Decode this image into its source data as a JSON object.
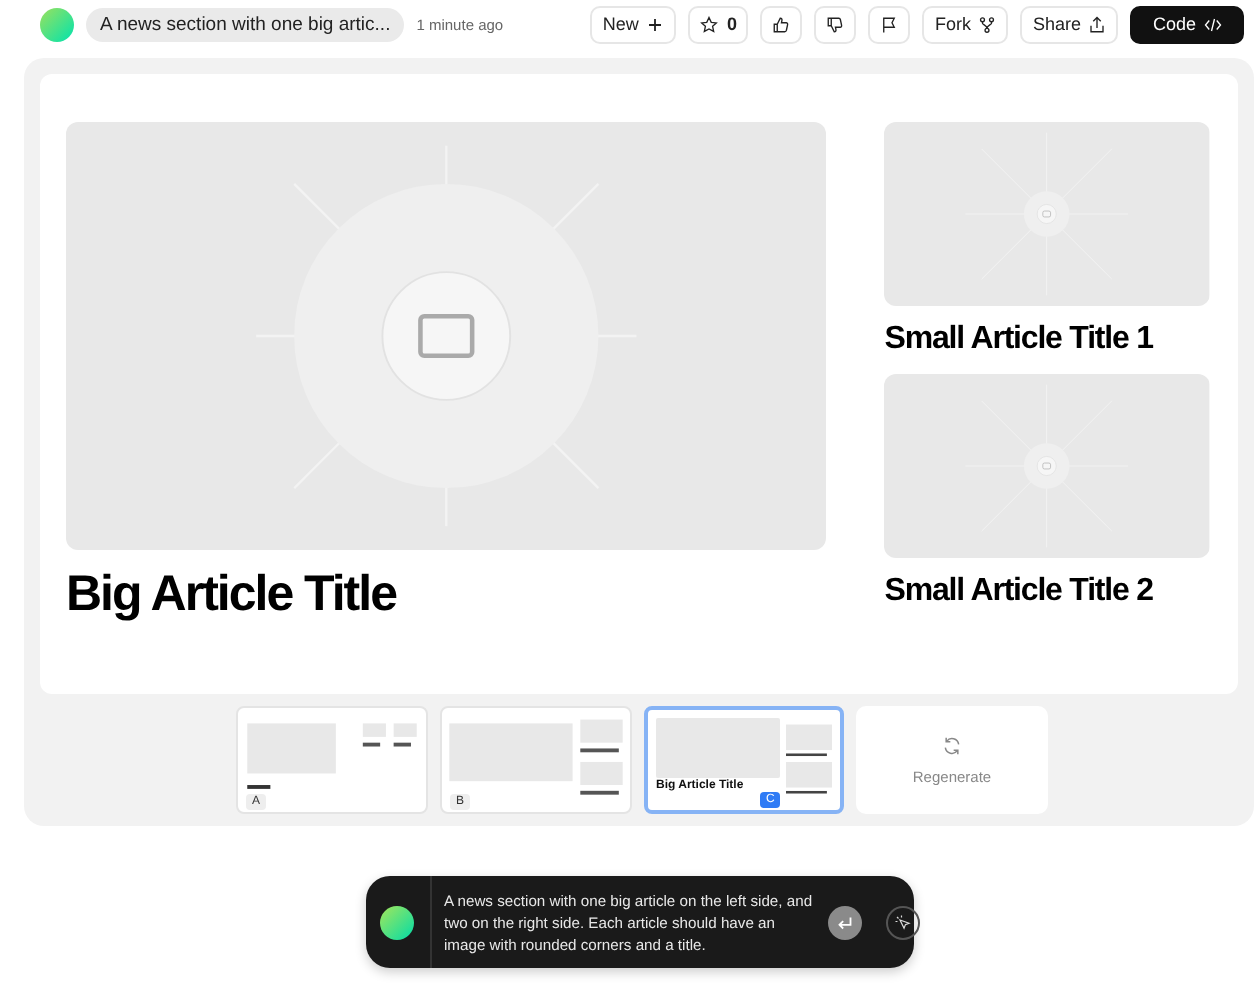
{
  "header": {
    "title": "A news section with one big artic...",
    "time": "1 minute ago",
    "buttons": [
      {
        "kind": "new",
        "label": "New"
      },
      {
        "kind": "star",
        "label": "0"
      },
      {
        "kind": "like"
      },
      {
        "kind": "dislike"
      },
      {
        "kind": "flag"
      },
      {
        "kind": "fork",
        "label": "Fork"
      },
      {
        "kind": "share",
        "label": "Share"
      },
      {
        "kind": "code",
        "label": "Code"
      }
    ]
  },
  "preview": {
    "big": {
      "title": "Big Article Title"
    },
    "small": [
      {
        "title": "Small Article Title 1"
      },
      {
        "title": "Small Article Title 2"
      }
    ]
  },
  "variants": [
    {
      "letter": "A",
      "kind": "grid",
      "selected": false
    },
    {
      "letter": "B",
      "kind": "split",
      "selected": false
    },
    {
      "letter": "C",
      "kind": "titled",
      "selected": true,
      "big_title": "Big Article Title"
    }
  ],
  "regenerate": {
    "label": "Regenerate"
  },
  "prompt": {
    "text": "A news section with one big article on the left side, and two on the right side. Each article should have an image with rounded corners and a title."
  }
}
